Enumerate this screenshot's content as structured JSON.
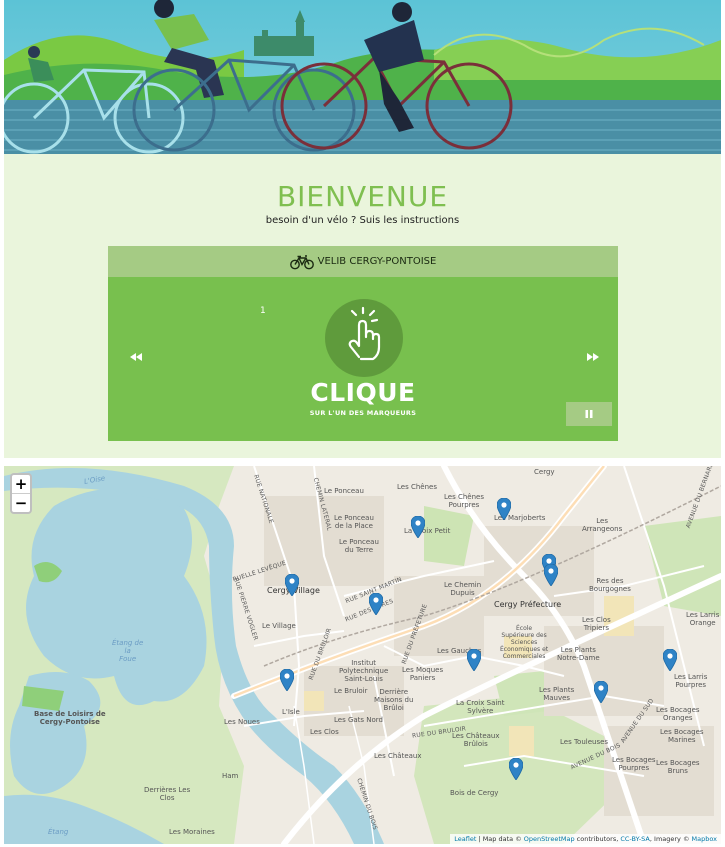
{
  "welcome": {
    "title": "BIENVENUE",
    "subtitle": "besoin d'un vélo ? Suis les instructions"
  },
  "slider": {
    "header_label": "VELIB CERGY-PONTOISE",
    "slide_number": "1",
    "headline": "CLIQUE",
    "subline": "SUR L'UN DES MARQUEURS",
    "icons": {
      "header": "bicycle-icon",
      "prev": "rewind-icon",
      "next": "fast-forward-icon",
      "pause": "pause-icon",
      "hand": "tap-hand-icon"
    },
    "colors": {
      "panel": "#78c04e",
      "header": "#a5cb84",
      "circle": "#5f9b3c"
    }
  },
  "map": {
    "zoom_in": "+",
    "zoom_out": "−",
    "attribution": {
      "leaflet": "Leaflet",
      "sep1": " | Map data © ",
      "osm": "OpenStreetMap",
      "sep2": " contributors, ",
      "license": "CC-BY-SA",
      "sep3": ", Imagery © ",
      "mapbox": "Mapbox"
    },
    "labels": {
      "cergy": "Cergy",
      "le_ponceau": "Le Ponceau",
      "les_chenes": "Les Chênes",
      "les_chenes_pourpres": "Les Chênes\nPourpres",
      "les_maradas": "Les Marjoberts",
      "le_ponceau_place": "Le Ponceau\nde la Place",
      "la_croix_petit": "La Croix Petit",
      "le_ponceau_terre": "Le Ponceau\ndu Terre",
      "les_arrangeons": "Les\nArrangeons",
      "rue_saint_martin": "RUE SAINT MARTIN",
      "rue_des_cures": "RUE DES CURES",
      "le_chemin_dupuis": "Le Chemin\nDupuis",
      "cergy_prefecture": "Cergy Préfecture",
      "res_bourgognes": "Res des\nBourgognes",
      "cergy_village": "Cergy Village",
      "le_village": "Le Village",
      "etang_foue": "Étang de\nla\nFoue",
      "ecole": "École\nSupérieure des\nSciences\nÉconomiques et\nCommerciales",
      "les_clos_tripiers": "Les Clos\nTripiers",
      "les_larris_orange": "Les Larris\nOrange",
      "institut": "Institut\nPolytechnique\nSaint-Louis",
      "les_gauches": "Les Gauches",
      "les_plants_nd": "Les Plants\nNotre-Dame",
      "les_moques": "Les Moques\nPaniers",
      "le_bruloir": "Le Bruloir",
      "derriere": "Derrière\nMaisons du\nBrûloi",
      "base_loisirs": "Base de Loisirs de\nCergy-Pontoise",
      "l_isle": "L'Isle",
      "les_noues": "Les Noues",
      "les_gats_nord": "Les Gats Nord",
      "les_clos": "Les Clos",
      "la_croix_saint": "La Croix Saint\nSylvère",
      "les_plants_mauves": "Les Plants\nMauves",
      "les_larris_pourpres": "Les Larris\nPourpres",
      "les_bocages_oranges": "Les Bocages\nOranges",
      "les_bocages_marines": "Les Bocages\nMarines",
      "les_chateaux_brulois": "Les Châteaux\nBrûlois",
      "les_chateaux": "Les Châteaux",
      "les_touleuses": "Les Touleuses",
      "les_bocages_pourpres": "Les Bocages\nPourpres",
      "les_bocages_bruns": "Les Bocages\nBruns",
      "ham": "Ham",
      "derrieres_clos": "Derrières Les\nClos",
      "bois_cergy": "Bois de Cergy",
      "les_moraines": "Les Moraines",
      "etang": "Étang",
      "l_oise": "L'Oise",
      "avenue_bernard": "AVENUE DU BERNARD",
      "rue_nationale": "RUE NATIONALE",
      "rue_pierre_vogler": "RUE PIERRE VOGLER",
      "rue_du_bruloir": "RUE DU BRULOIR",
      "avenue_du_sud": "AVENUE DU SUD",
      "avenue_bois": "AVENUE DU BOIS",
      "rue_bruloir2": "RUE DU BRULOIR",
      "chemin_lateral": "CHEMIN LATERAL",
      "chemin_bois": "CHEMIN DU BOIS",
      "rue_prefecture": "RUE DU PRÉFETURE",
      "rue_levesque": "RUELLE LEVÊQUE"
    }
  }
}
